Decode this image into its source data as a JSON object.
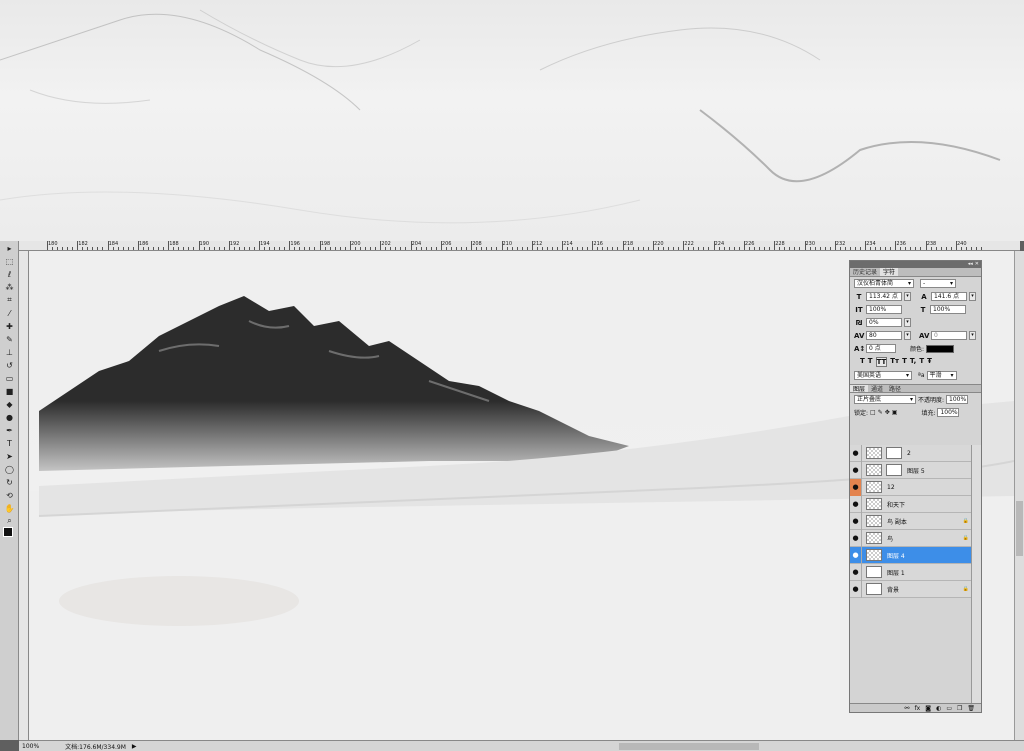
{
  "ruler": {
    "top_labels": [
      "180",
      "182",
      "184",
      "186",
      "188",
      "190",
      "192",
      "194",
      "196",
      "198",
      "200",
      "202",
      "204",
      "206",
      "208",
      "210",
      "212",
      "214",
      "216",
      "218",
      "220",
      "222",
      "224",
      "226",
      "228",
      "230",
      "232",
      "234",
      "236",
      "238",
      "240"
    ]
  },
  "tools": [
    {
      "icon": "move-tool-icon",
      "glyph": "▸"
    },
    {
      "icon": "marquee-tool-icon",
      "glyph": "⬚"
    },
    {
      "icon": "lasso-tool-icon",
      "glyph": "ℓ"
    },
    {
      "icon": "magic-wand-tool-icon",
      "glyph": "⁂"
    },
    {
      "icon": "crop-tool-icon",
      "glyph": "⌗"
    },
    {
      "icon": "eyedropper-tool-icon",
      "glyph": "⁄"
    },
    {
      "icon": "healing-brush-tool-icon",
      "glyph": "✚"
    },
    {
      "icon": "brush-tool-icon",
      "glyph": "✎"
    },
    {
      "icon": "clone-stamp-tool-icon",
      "glyph": "⊥"
    },
    {
      "icon": "history-brush-tool-icon",
      "glyph": "↺"
    },
    {
      "icon": "eraser-tool-icon",
      "glyph": "▭"
    },
    {
      "icon": "gradient-tool-icon",
      "glyph": "■"
    },
    {
      "icon": "blur-tool-icon",
      "glyph": "◆"
    },
    {
      "icon": "dodge-tool-icon",
      "glyph": "●"
    },
    {
      "icon": "pen-tool-icon",
      "glyph": "✒"
    },
    {
      "icon": "type-tool-icon",
      "glyph": "T"
    },
    {
      "icon": "path-selection-tool-icon",
      "glyph": "➤"
    },
    {
      "icon": "shape-tool-icon",
      "glyph": "◯"
    },
    {
      "icon": "3d-rotate-tool-icon",
      "glyph": "↻"
    },
    {
      "icon": "3d-orbit-tool-icon",
      "glyph": "⟲"
    },
    {
      "icon": "hand-tool-icon",
      "glyph": "✋"
    },
    {
      "icon": "zoom-tool-icon",
      "glyph": "⌕"
    }
  ],
  "status": {
    "zoom": "100%",
    "doc": "文档:176.6M/334.9M"
  },
  "character_panel": {
    "tabs": [
      "历史记录",
      "字符"
    ],
    "font_family": "汉仪柏青体简",
    "font_style": "-",
    "font_size": "113.42 点",
    "leading": "141.6 点",
    "vertical_scale": "100%",
    "horizontal_scale": "100%",
    "tsume": "0%",
    "kerning": "80",
    "tracking": "0",
    "baseline_shift": "0 点",
    "color_label": "颜色:",
    "text_color": "#000000",
    "format_buttons": [
      "T",
      "T",
      "TT",
      "Tт",
      "T",
      "T,",
      "T",
      "Ŧ"
    ],
    "language": "美国英语",
    "aa_label": "ªa",
    "antialias": "平滑"
  },
  "layers_panel": {
    "tabs": [
      "图层",
      "通道",
      "路径"
    ],
    "blend_mode": "正片叠底",
    "opacity_label": "不透明度:",
    "opacity": "100%",
    "lock_label": "锁定:",
    "fill_label": "填充:",
    "fill": "100%",
    "layers": [
      {
        "name": "2",
        "has_mask": true,
        "selected": false,
        "orange_eye": false,
        "locked": false,
        "white": false
      },
      {
        "name": "图层 5",
        "has_mask": true,
        "selected": false,
        "orange_eye": false,
        "locked": false,
        "white": false
      },
      {
        "name": "12",
        "has_mask": false,
        "selected": false,
        "orange_eye": true,
        "locked": false,
        "white": false
      },
      {
        "name": "和天下",
        "has_mask": false,
        "selected": false,
        "orange_eye": false,
        "locked": false,
        "white": false
      },
      {
        "name": "鸟 副本",
        "has_mask": false,
        "selected": false,
        "orange_eye": false,
        "locked": true,
        "white": false
      },
      {
        "name": "鸟",
        "has_mask": false,
        "selected": false,
        "orange_eye": false,
        "locked": true,
        "white": false
      },
      {
        "name": "图层 4",
        "has_mask": false,
        "selected": true,
        "orange_eye": false,
        "locked": false,
        "white": false
      },
      {
        "name": "图层 1",
        "has_mask": false,
        "selected": false,
        "orange_eye": false,
        "locked": false,
        "white": true
      },
      {
        "name": "背景",
        "has_mask": false,
        "selected": false,
        "orange_eye": false,
        "locked": true,
        "white": true
      }
    ],
    "bottom_icons": [
      "link-icon",
      "fx-icon",
      "mask-icon",
      "adjustment-icon",
      "folder-icon",
      "new-layer-icon",
      "trash-icon"
    ]
  }
}
